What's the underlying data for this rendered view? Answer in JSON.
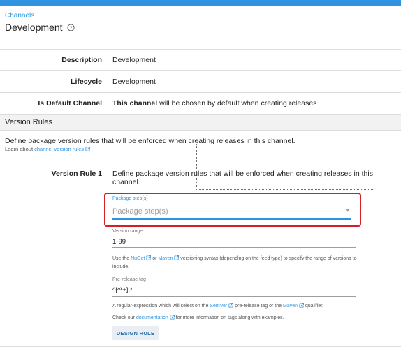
{
  "header": {
    "breadcrumb": "Channels",
    "title": "Development"
  },
  "details": {
    "description_label": "Description",
    "description_value": "Development",
    "lifecycle_label": "Lifecycle",
    "lifecycle_value": "Development",
    "default_label": "Is Default Channel",
    "default_value_bold": "This channel",
    "default_value_rest": " will be chosen by default when creating releases"
  },
  "version_rules": {
    "section_title": "Version Rules",
    "intro": "Define package version rules that will be enforced when creating releases in this channel.",
    "learn_prefix": "Learn about ",
    "learn_link": "channel version rules",
    "rule_label": "Version Rule 1",
    "rule_description": "Define package version rules that will be enforced when creating releases in this channel."
  },
  "form": {
    "package_steps_label": "Package step(s)",
    "package_steps_placeholder": "Package step(s)",
    "version_range_label": "Version range",
    "version_range_value": "1-99",
    "version_help_1": "Use the ",
    "version_help_nuget": "NuGet",
    "version_help_2": " or ",
    "version_help_maven": "Maven",
    "version_help_3": " versioning syntax (depending on the feed type) to specify the range of versions to include.",
    "prerelease_label": "Pre-release tag",
    "prerelease_value": "^[^\\+].*",
    "prerelease_help_1": "A regular-expression which will select on the ",
    "prerelease_help_semver": "SemVer",
    "prerelease_help_2": " pre-release tag or the ",
    "prerelease_help_maven": "Maven",
    "prerelease_help_3": " qualifier.",
    "docs_help_1": "Check our ",
    "docs_help_link": "documentation",
    "docs_help_2": " for more information on tags along with examples.",
    "design_button": "DESIGN RULE"
  },
  "colors": {
    "accent": "#2f93e0",
    "highlight": "#d32026"
  }
}
